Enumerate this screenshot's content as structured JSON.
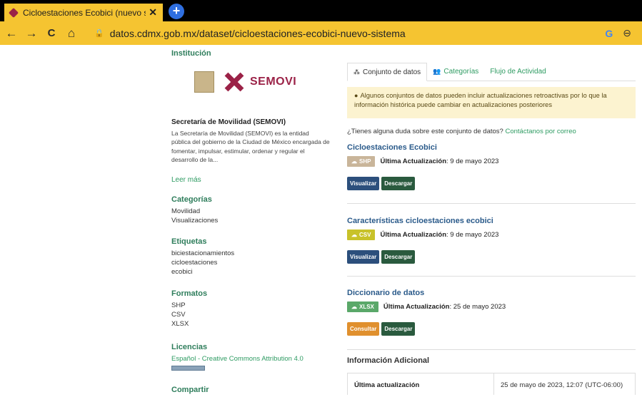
{
  "browser": {
    "tab_title": "Cicloestaciones Ecobici (nuevo si",
    "tab_close": "✕",
    "new_tab": "+",
    "url": "datos.cdmx.gob.mx/dataset/cicloestaciones-ecobici-nuevo-sistema",
    "back": "←",
    "forward": "→",
    "reload": "C",
    "home": "⌂",
    "google": "G",
    "zoom": "⊖"
  },
  "sidebar": {
    "institucion_label": "Institución",
    "logo_text": "SEMOVI",
    "org_title": "Secretaría de Movilidad (SEMOVI)",
    "org_desc": "La Secretaría de Movilidad (SEMOVI) es la entidad pública del gobierno de la Ciudad de México encargada de fomentar, impulsar, estimular, ordenar y regular el desarrollo de la...",
    "read_more": "Leer más",
    "categorias": {
      "title": "Categorías",
      "items": [
        "Movilidad",
        "Visualizaciones"
      ]
    },
    "etiquetas": {
      "title": "Etiquetas",
      "items": [
        "biciestacionamientos",
        "cicloestaciones",
        "ecobici"
      ]
    },
    "formatos": {
      "title": "Formatos",
      "items": [
        "SHP",
        "CSV",
        "XLSX"
      ]
    },
    "licencias": {
      "title": "Licencias",
      "link": "Español - Creative Commons Attribution 4.0",
      "badge": "OPEN DATA"
    },
    "compartir": {
      "title": "Compartir"
    }
  },
  "main": {
    "tabs": [
      {
        "icon": "⁂",
        "label": "Conjunto de datos"
      },
      {
        "icon": "👥",
        "label": "Categorías"
      },
      {
        "label": "Flujo de Actividad"
      }
    ],
    "alert_icon": "●",
    "alert_text": "Algunos conjuntos de datos pueden incluir actualizaciones retroactivas por lo que la información histórica puede cambiar en actualizaciones posteriores",
    "question_text": "¿Tienes alguna duda sobre este conjunto de datos?",
    "question_link": "Contáctanos por correo",
    "resources": [
      {
        "title": "Cicloestaciones Ecobici",
        "format": "SHP",
        "format_color": "#c9b59a",
        "updated_label": "Última Actualización",
        "updated_value": ": 9 de mayo 2023",
        "btn1": "Visualizar",
        "btn2": "Descargar"
      },
      {
        "title": "Características cicloestaciones ecobici",
        "format": "CSV",
        "format_color": "#c8c22a",
        "updated_label": "Última Actualización",
        "updated_value": ": 9 de mayo 2023",
        "btn1": "Visualizar",
        "btn2": "Descargar"
      },
      {
        "title": "Diccionario de datos",
        "format": "XLSX",
        "format_color": "#5aa869",
        "updated_label": "Última Actualización",
        "updated_value": ": 25 de mayo 2023",
        "btn1": "Consultar",
        "btn2": "Descargar"
      }
    ],
    "info_title": "Información Adicional",
    "info_rows": [
      {
        "key": "Última actualización",
        "value": "25 de mayo de 2023, 12:07 (UTC-06:00)"
      }
    ]
  },
  "colors": {
    "chrome": "#f5c431",
    "brand": "#9b2247",
    "link": "#2e9b62",
    "resource_title": "#2a5a8a"
  }
}
